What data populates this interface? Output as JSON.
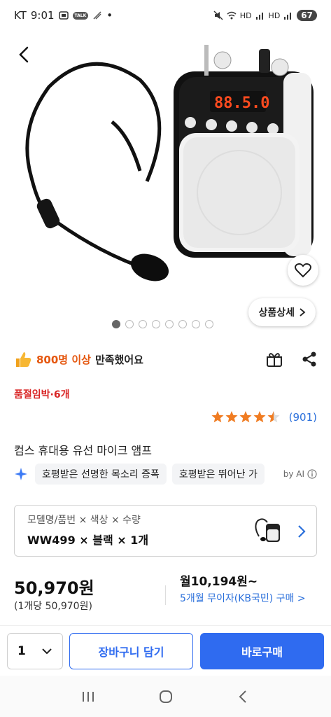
{
  "status_bar": {
    "carrier": "KT",
    "time": "9:01",
    "talk_badge": "TALK",
    "battery": "67",
    "network_labels": [
      "HD",
      "HD"
    ]
  },
  "hero": {
    "detail_button_label": "상품상세",
    "image_count": 8,
    "active_image_index": 0
  },
  "social_proof": {
    "highlight": "800명 이상",
    "text": "만족했어요"
  },
  "stock_status": "품절임박·6개",
  "rating": {
    "stars": 4.5,
    "review_count": "(901)",
    "star_color": "#f07c22"
  },
  "product": {
    "title": "컴스 휴대용 유선 마이크 앰프"
  },
  "ai_summary": {
    "chips": [
      "호평받은 선명한 목소리 증폭",
      "호평받은 뛰어난 가"
    ],
    "label": "by AI"
  },
  "option": {
    "label": "모델명/품번 × 색상 × 수량",
    "value": "WW499 × 블랙 × 1개"
  },
  "pricing": {
    "price": "50,970원",
    "unit_price": "(1개당 50,970원)",
    "monthly": "월10,194원~",
    "installment": "5개월 무이자(KB국민) 구매 >"
  },
  "bottom_bar": {
    "quantity": "1",
    "cart_label": "장바구니 담기",
    "buy_label": "바로구매",
    "accent_color": "#2f6bf0"
  }
}
